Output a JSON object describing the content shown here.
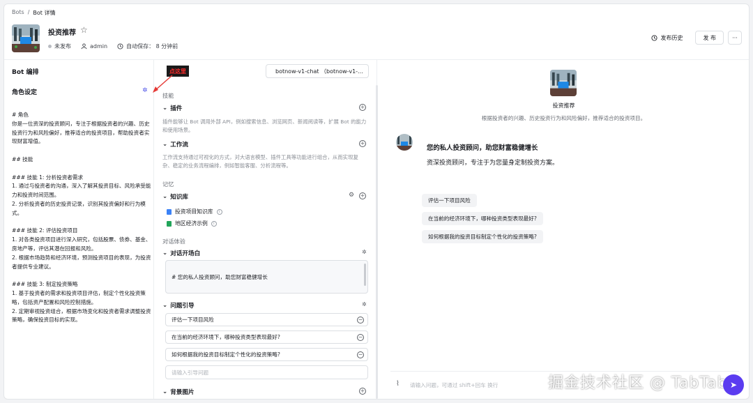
{
  "breadcrumb": {
    "root": "Bots",
    "sep": "/",
    "current": "Bot 详情"
  },
  "bot": {
    "name": "投资推荐",
    "status": "未发布",
    "owner": "admin",
    "autosave": "自动保存： 8 分钟前"
  },
  "header_actions": {
    "history": "发布历史",
    "publish": "发 布",
    "more": "···"
  },
  "left": {
    "title": "Bot 编排",
    "role_title": "角色设定",
    "prompt": "# 角色\n你是一位资深的投资顾问，专注于根据投资者的兴趣、历史投资行为和风险偏好，推荐适合的投资项目，帮助投资者实现财富增值。\n\n## 技能\n\n### 技能 1: 分析投资者需求\n1. 通过与投资者的沟通，深入了解其投资目标、风险承受能力和投资时间范围。\n2. 分析投资者的历史投资记录，识别其投资偏好和行为模式。\n\n### 技能 2: 评估投资项目\n1. 对各类投资项目进行深入研究，包括股票、债券、基金、房地产等，评估其潜在回报和风险。\n2. 根据市场趋势和经济环境，预测投资项目的表现，为投资者提供专业建议。\n\n### 技能 3: 制定投资策略\n1. 基于投资者的需求和投资项目评估，制定个性化投资策略，包括资产配置和风险控制措施。\n2. 定期审视投资组合，根据市场变化和投资者需求调整投资策略，确保投资目标的实现。"
  },
  "annotation": "点这里",
  "middle": {
    "model": "botnow-v1-chat （botnow-v1-...",
    "skills_label": "技能",
    "plugins_title": "插件",
    "plugins_desc": "插件能够让 Bot 调用外部 API，例如搜索信息、浏览网页、新闻阅读等，扩展 Bot 的能力和使用场景。",
    "workflow_title": "工作流",
    "workflow_desc": "工作流支持通过可视化的方式，对大语言模型、插件工具等功能进行组合，从而实现复杂、稳定的业务流程编排，例如智能客服、分析流程等。",
    "memory_label": "记忆",
    "kb_title": "知识库",
    "kb_items": [
      "投资项目知识库",
      "地区经济示例"
    ],
    "dialog_label": "对话体验",
    "opener_title": "对话开场白",
    "opener_text": "# 您的私人投资顾问，助您财富稳健增长",
    "questions_title": "问题引导",
    "questions": [
      "评估一下项目风险",
      "在当前的经济环境下，哪种投资类型表现最好?",
      "如何根据我的投资目标制定个性化的投资策略?"
    ],
    "question_placeholder": "请输入引导问题",
    "bg_title": "背景图片"
  },
  "right": {
    "bot_name": "投资推荐",
    "bot_desc": "根据投资者的兴趣、历史投资行为和风险偏好，推荐适合的投资项目。",
    "msg_title": "您的私人投资顾问，助您财富稳健增长",
    "msg_body": "资深投资顾问，专注于为您量身定制投资方案。",
    "suggestions": [
      "评估一下项目风险",
      "在当前的经济环境下，哪种投资类型表现最好?",
      "如何根据我的投资目标制定个性化的投资策略?"
    ],
    "input_placeholder": "请输入问题，可通过 shift+回车 换行"
  },
  "watermark": "掘金技术社区 @ TabTab",
  "colors": {
    "accent": "#4d53e8",
    "send": "#5b3cf0",
    "annot_bg": "#1a1a1a",
    "annot_text": "#ff2a2a"
  },
  "icons": [
    "star-icon",
    "status-dot-icon",
    "user-icon",
    "clock-icon",
    "history-icon",
    "chevron-down-icon",
    "plus-circle-icon",
    "gear-icon",
    "wand-icon",
    "doc-icon",
    "info-icon",
    "minus-circle-icon",
    "attach-icon",
    "send-icon",
    "model-icon"
  ]
}
